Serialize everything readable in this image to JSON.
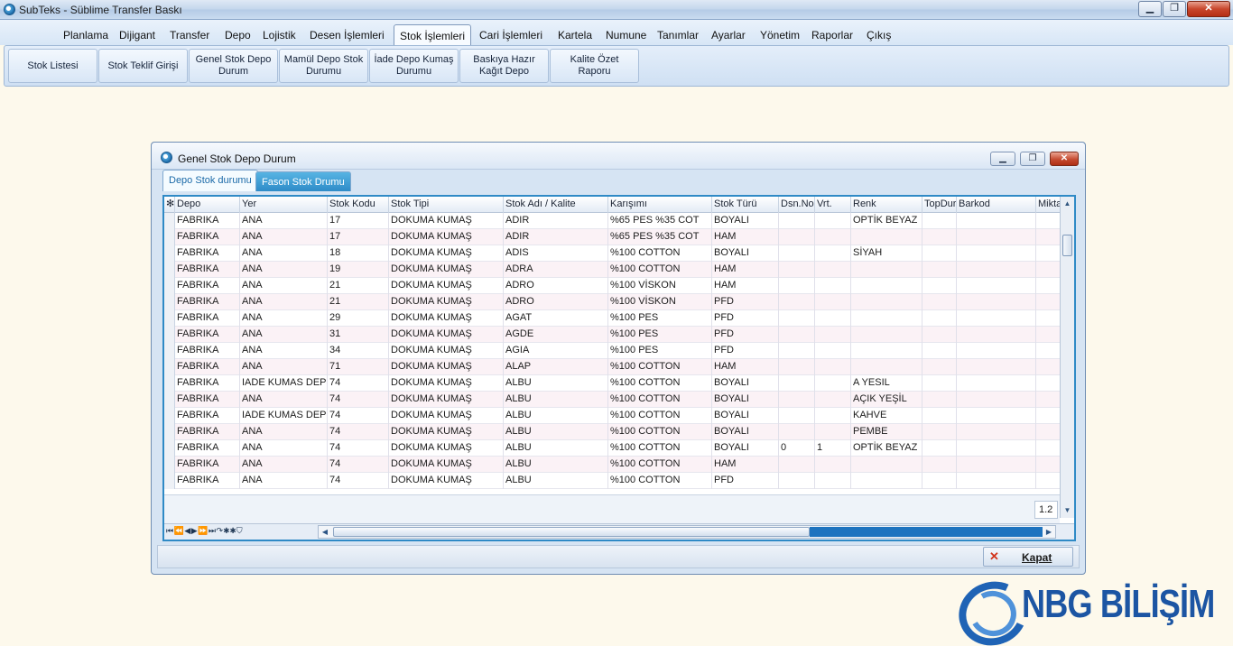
{
  "window": {
    "title": "SubTeks - Süblime Transfer Baskı",
    "minimize": "▁",
    "maximize": "❐",
    "close": "✕"
  },
  "menu": [
    {
      "label": "Planlama"
    },
    {
      "label": "Dijigant"
    },
    {
      "label": "Transfer"
    },
    {
      "label": "Depo"
    },
    {
      "label": "Lojistik"
    },
    {
      "label": "Desen İşlemleri"
    },
    {
      "label": "Stok İşlemleri"
    },
    {
      "label": "Cari İşlemleri"
    },
    {
      "label": "Kartela"
    },
    {
      "label": "Numune"
    },
    {
      "label": "Tanımlar"
    },
    {
      "label": "Ayarlar"
    },
    {
      "label": "Yönetim"
    },
    {
      "label": "Raporlar"
    },
    {
      "label": "Çıkış"
    }
  ],
  "ribbon": [
    {
      "label": "Stok Listesi"
    },
    {
      "label": "Stok Teklif Girişi"
    },
    {
      "label": "Genel Stok Depo Durum"
    },
    {
      "label": "Mamül Depo Stok Durumu"
    },
    {
      "label": "İade Depo Kumaş Durumu"
    },
    {
      "label": "Baskıya Hazır Kağıt Depo"
    },
    {
      "label": "Kalite Özet Raporu"
    }
  ],
  "child": {
    "title": "Genel Stok Depo Durum",
    "tabs": [
      {
        "label": "Depo Stok durumu"
      },
      {
        "label": "Fason Stok Drumu"
      }
    ],
    "columns": [
      "✻",
      "Depo",
      "Yer",
      "Stok Kodu",
      "Stok Tipi",
      "Stok Adı / Kalite",
      "Karışımı",
      "Stok Türü",
      "Dsn.No",
      "Vrt.",
      "Renk",
      "TopDur",
      "Barkod",
      "Mikta"
    ],
    "rows": [
      [
        "FABRIKA",
        "ANA",
        "17",
        "DOKUMA KUMAŞ",
        "ADIR",
        "%65 PES %35 COT",
        "BOYALI",
        "",
        "",
        "OPTİK BEYAZ",
        "",
        ""
      ],
      [
        "FABRIKA",
        "ANA",
        "17",
        "DOKUMA KUMAŞ",
        "ADIR",
        "%65 PES %35 COT",
        "HAM",
        "",
        "",
        "",
        "",
        ""
      ],
      [
        "FABRIKA",
        "ANA",
        "18",
        "DOKUMA KUMAŞ",
        "ADIS",
        "%100 COTTON",
        "BOYALI",
        "",
        "",
        "SİYAH",
        "",
        ""
      ],
      [
        "FABRIKA",
        "ANA",
        "19",
        "DOKUMA KUMAŞ",
        "ADRA",
        "%100 COTTON",
        "HAM",
        "",
        "",
        "",
        "",
        ""
      ],
      [
        "FABRIKA",
        "ANA",
        "21",
        "DOKUMA KUMAŞ",
        "ADRO",
        "%100 VİSKON",
        "HAM",
        "",
        "",
        "",
        "",
        ""
      ],
      [
        "FABRIKA",
        "ANA",
        "21",
        "DOKUMA KUMAŞ",
        "ADRO",
        "%100 VİSKON",
        "PFD",
        "",
        "",
        "",
        "",
        ""
      ],
      [
        "FABRIKA",
        "ANA",
        "29",
        "DOKUMA KUMAŞ",
        "AGAT",
        "%100 PES",
        "PFD",
        "",
        "",
        "",
        "",
        ""
      ],
      [
        "FABRIKA",
        "ANA",
        "31",
        "DOKUMA KUMAŞ",
        "AGDE",
        "%100 PES",
        "PFD",
        "",
        "",
        "",
        "",
        ""
      ],
      [
        "FABRIKA",
        "ANA",
        "34",
        "DOKUMA KUMAŞ",
        "AGIA",
        "%100 PES",
        "PFD",
        "",
        "",
        "",
        "",
        ""
      ],
      [
        "FABRIKA",
        "ANA",
        "71",
        "DOKUMA KUMAŞ",
        "ALAP",
        "%100 COTTON",
        "HAM",
        "",
        "",
        "",
        "",
        ""
      ],
      [
        "FABRIKA",
        "IADE KUMAS DEPO",
        "74",
        "DOKUMA KUMAŞ",
        "ALBU",
        "%100 COTTON",
        "BOYALI",
        "",
        "",
        "A YESIL",
        "",
        ""
      ],
      [
        "FABRIKA",
        "ANA",
        "74",
        "DOKUMA KUMAŞ",
        "ALBU",
        "%100 COTTON",
        "BOYALI",
        "",
        "",
        "AÇIK YEŞİL",
        "",
        ""
      ],
      [
        "FABRIKA",
        "IADE KUMAS DEPO",
        "74",
        "DOKUMA KUMAŞ",
        "ALBU",
        "%100 COTTON",
        "BOYALI",
        "",
        "",
        "KAHVE",
        "",
        ""
      ],
      [
        "FABRIKA",
        "ANA",
        "74",
        "DOKUMA KUMAŞ",
        "ALBU",
        "%100 COTTON",
        "BOYALI",
        "",
        "",
        "PEMBE",
        "",
        ""
      ],
      [
        "FABRIKA",
        "ANA",
        "74",
        "DOKUMA KUMAŞ",
        "ALBU",
        "%100 COTTON",
        "BOYALI",
        "0",
        "1",
        "OPTİK BEYAZ",
        "",
        ""
      ],
      [
        "FABRIKA",
        "ANA",
        "74",
        "DOKUMA KUMAŞ",
        "ALBU",
        "%100 COTTON",
        "HAM",
        "",
        "",
        "",
        "",
        ""
      ],
      [
        "FABRIKA",
        "ANA",
        "74",
        "DOKUMA KUMAŞ",
        "ALBU",
        "%100 COTTON",
        "PFD",
        "",
        "",
        "",
        "",
        ""
      ]
    ],
    "footer_value": "1.2",
    "navigator": "⏮ ⏪ ◀ ▶ ⏩ ⏭ ↷ ✱ ✱ ⛉",
    "close_button": "Kapat"
  },
  "logo": {
    "text": "NBG BİLİŞİM"
  },
  "colors": {
    "accent": "#2f8ac6",
    "background": "#fdf9ec",
    "logo": "#1c55a3"
  }
}
